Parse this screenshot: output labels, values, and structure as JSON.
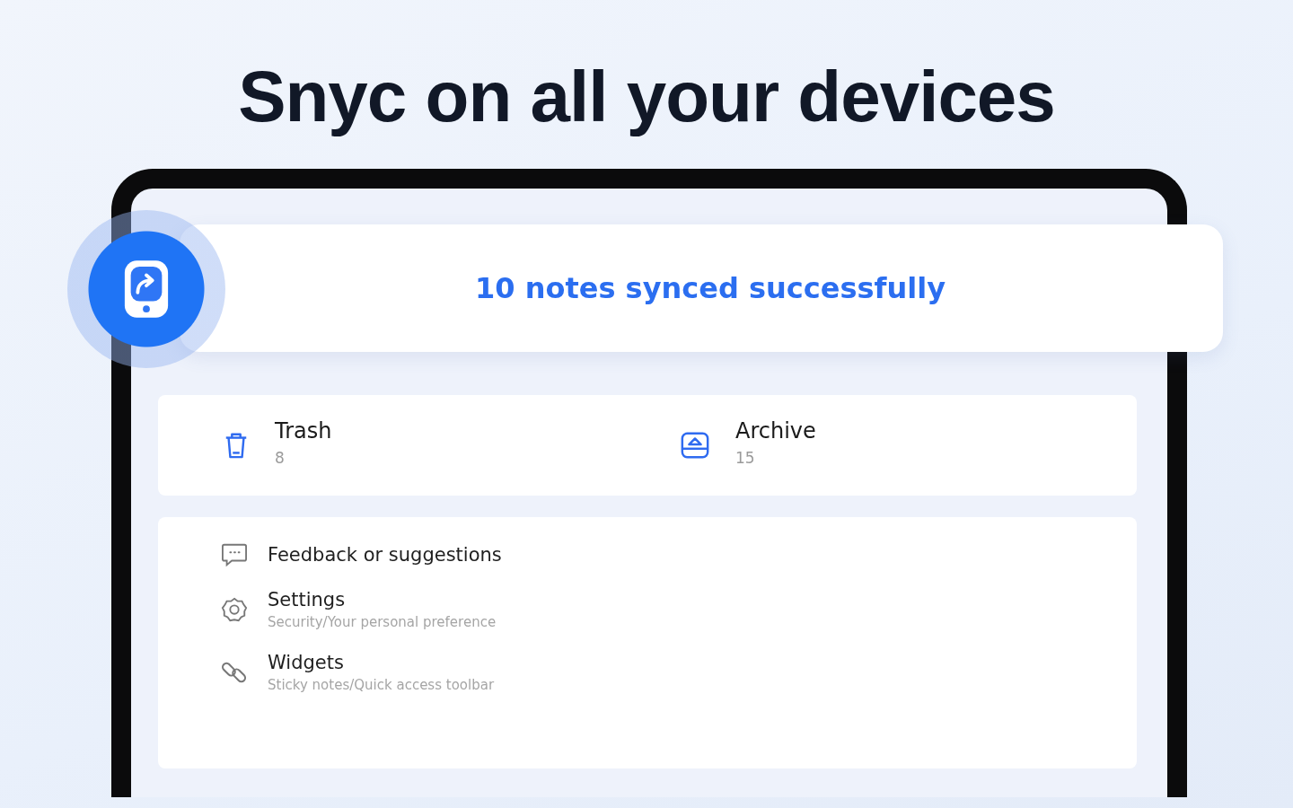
{
  "headline": "Snyc on all your devices",
  "toast": {
    "message": "10 notes synced successfully"
  },
  "folders": [
    {
      "kind": "trash",
      "name": "Trash",
      "count": "8"
    },
    {
      "kind": "archive",
      "name": "Archive",
      "count": "15"
    }
  ],
  "menu": [
    {
      "kind": "feedback",
      "title": "Feedback or suggestions"
    },
    {
      "kind": "settings",
      "title": "Settings",
      "subtitle": "Security/Your personal preference"
    },
    {
      "kind": "widgets",
      "title": "Widgets",
      "subtitle": "Sticky notes/Quick access toolbar"
    }
  ]
}
